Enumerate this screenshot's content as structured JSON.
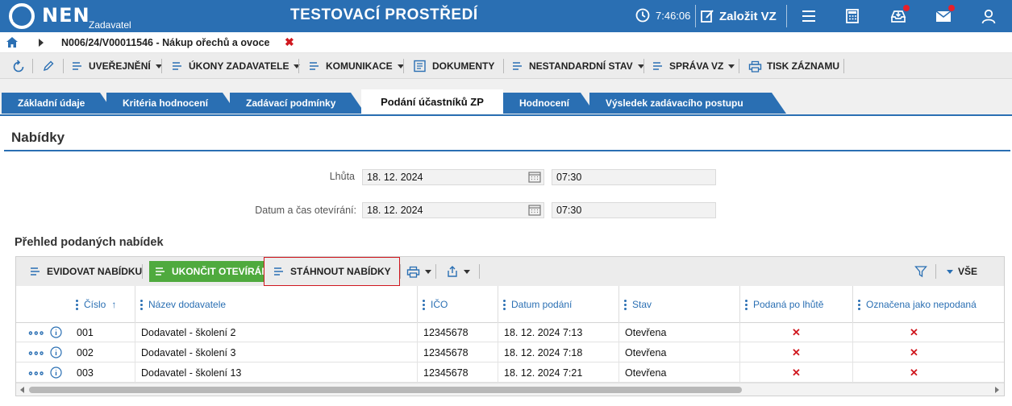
{
  "header": {
    "brand": "NEN",
    "brand_sub": "Zadavatel",
    "env_title": "TESTOVACÍ PROSTŘEDÍ",
    "clock": "7:46:06",
    "new_vz_label": "Založit VZ",
    "icons": [
      "menu-icon",
      "calculator-icon",
      "inbox-icon",
      "mail-icon",
      "user-icon"
    ]
  },
  "breadcrumb": {
    "text": "N006/24/V00011546 - Nákup ořechů a ovoce",
    "close": "✖"
  },
  "toolbar": {
    "items": [
      "UVEŘEJNĚNÍ",
      "ÚKONY ZADAVATELE",
      "KOMUNIKACE",
      "DOKUMENTY",
      "NESTANDARDNÍ STAV",
      "SPRÁVA VZ",
      "TISK ZÁZNAMU"
    ]
  },
  "tabs": [
    {
      "label": "Základní údaje"
    },
    {
      "label": "Kritéria hodnocení"
    },
    {
      "label": "Zadávací podmínky"
    },
    {
      "label": "Podání účastníků ZP",
      "active": true
    },
    {
      "label": "Hodnocení"
    },
    {
      "label": "Výsledek zadávacího postupu"
    }
  ],
  "section": {
    "title": "Nabídky"
  },
  "form": {
    "deadline_label": "Lhůta",
    "deadline_date": "18. 12. 2024",
    "deadline_time": "07:30",
    "opening_label": "Datum a čas otevírání:",
    "opening_date": "18. 12. 2024",
    "opening_time": "07:30"
  },
  "offers": {
    "title": "Přehled podaných nabídek",
    "buttons": {
      "register": "EVIDOVAT NABÍDKU",
      "finish_opening": "UKONČIT OTEVÍRÁNÍ",
      "download": "STÁHNOUT NABÍDKY",
      "filter_all": "VŠE"
    },
    "columns": [
      "Číslo",
      "Název dodavatele",
      "IČO",
      "Datum podání",
      "Stav",
      "Podaná po lhůtě",
      "Označena jako nepodaná"
    ],
    "rows": [
      {
        "num": "001",
        "supplier": "Dodavatel - školení 2",
        "ico": "12345678",
        "date": "18. 12. 2024 7:13",
        "status": "Otevřena",
        "late": "✕",
        "not_submitted": "✕"
      },
      {
        "num": "002",
        "supplier": "Dodavatel - školení 3",
        "ico": "12345678",
        "date": "18. 12. 2024 7:18",
        "status": "Otevřena",
        "late": "✕",
        "not_submitted": "✕"
      },
      {
        "num": "003",
        "supplier": "Dodavatel - školení 13",
        "ico": "12345678",
        "date": "18. 12. 2024 7:21",
        "status": "Otevřena",
        "late": "✕",
        "not_submitted": "✕"
      }
    ]
  },
  "colors": {
    "primary": "#2a6fb3",
    "green": "#4faa3e",
    "red": "#d0181f"
  }
}
